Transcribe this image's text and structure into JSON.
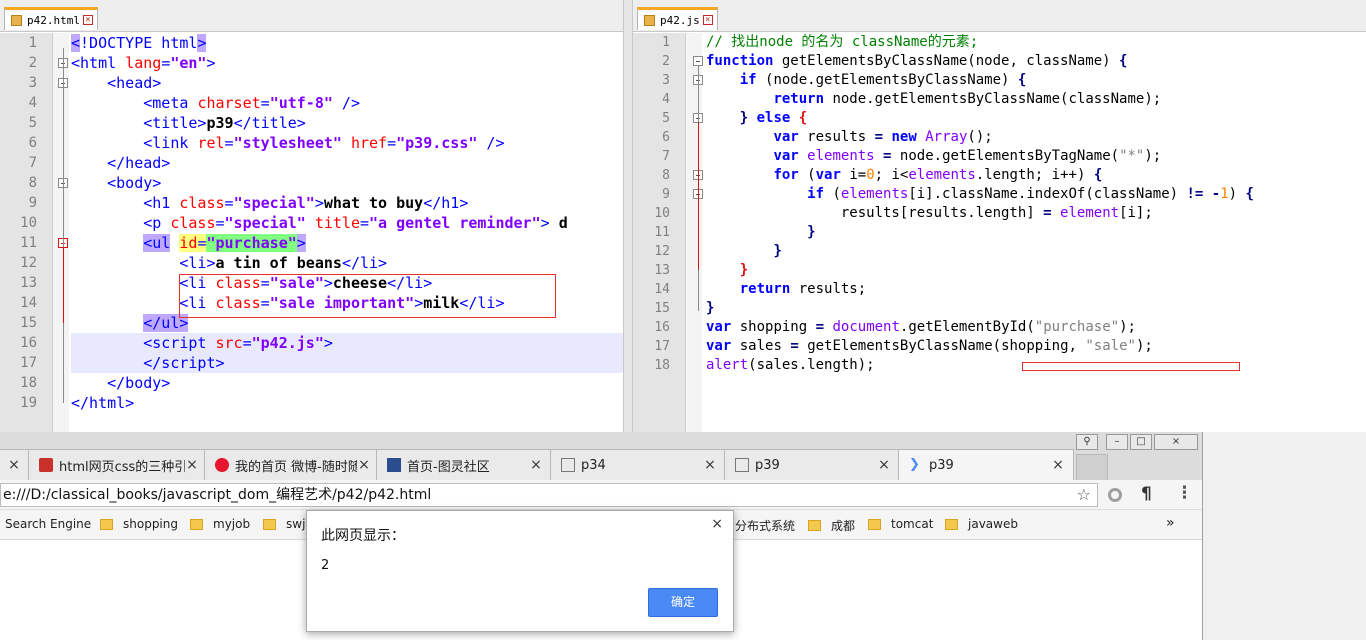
{
  "left_editor": {
    "tab_label": "p42.html",
    "lines": [
      {
        "n": "1",
        "html": "<span class='tg sel-tag'>&lt;</span><span class='tg'>!DOCTYPE html</span><span class='tg sel-tag'>&gt;</span>"
      },
      {
        "n": "2",
        "html": "<span class='tg'>&lt;html </span><span class='at'>lang</span><span class='tg'>=</span><span class='av'>\"en\"</span><span class='tg'>&gt;</span>"
      },
      {
        "n": "3",
        "html": "    <span class='tg'>&lt;head&gt;</span>"
      },
      {
        "n": "4",
        "html": "        <span class='tg'>&lt;meta </span><span class='at'>charset</span><span class='tg'>=</span><span class='av'>\"utf-8\"</span><span class='tg'> /&gt;</span>"
      },
      {
        "n": "5",
        "html": "        <span class='tg'>&lt;title&gt;</span><span class='tx'>p39</span><span class='tg'>&lt;/title&gt;</span>"
      },
      {
        "n": "6",
        "html": "        <span class='tg'>&lt;link </span><span class='at'>rel</span><span class='tg'>=</span><span class='av'>\"stylesheet\"</span><span class='tg'> </span><span class='at'>href</span><span class='tg'>=</span><span class='av'>\"p39.css\"</span><span class='tg'> /&gt;</span>"
      },
      {
        "n": "7",
        "html": "    <span class='tg'>&lt;/head&gt;</span>"
      },
      {
        "n": "8",
        "html": "    <span class='tg'>&lt;body&gt;</span>"
      },
      {
        "n": "9",
        "html": "        <span class='tg'>&lt;h1 </span><span class='at'>class</span><span class='tg'>=</span><span class='av'>\"special\"</span><span class='tg'>&gt;</span><span class='tx'>what to buy</span><span class='tg'>&lt;/h1&gt;</span>"
      },
      {
        "n": "10",
        "html": "        <span class='tg'>&lt;p </span><span class='at'>class</span><span class='tg'>=</span><span class='av'>\"special\"</span><span class='tg'> </span><span class='at'>title</span><span class='tg'>=</span><span class='av'>\"a gentel reminder\"</span><span class='tg'>&gt; </span><span class='tx'>d</span>"
      },
      {
        "n": "11",
        "html": "        <span class='tg sel-tag'>&lt;ul</span> <span class='at sel-attr'>id</span><span class='tg sel-attr'>=</span><span class='av sel-val'>\"purchase\"</span><span class='tg sel-tag'>&gt;</span>"
      },
      {
        "n": "12",
        "html": "            <span class='tg'>&lt;li&gt;</span><span class='tx'>a tin of beans</span><span class='tg'>&lt;/li&gt;</span>"
      },
      {
        "n": "13",
        "html": "            <span class='tg'>&lt;li </span><span class='at'>class</span><span class='tg'>=</span><span class='av'>\"sale\"</span><span class='tg'>&gt;</span><span class='tx'>cheese</span><span class='tg'>&lt;/li&gt;</span>"
      },
      {
        "n": "14",
        "html": "            <span class='tg'>&lt;li </span><span class='at'>class</span><span class='tg'>=</span><span class='av'>\"sale important\"</span><span class='tg'>&gt;</span><span class='tx'>milk</span><span class='tg'>&lt;/li&gt;</span>"
      },
      {
        "n": "15",
        "html": "        <span class='tg sel-tag'>&lt;/ul&gt;</span>"
      },
      {
        "n": "16",
        "html": "        <span class='tg'>&lt;script </span><span class='at'>src</span><span class='tg'>=</span><span class='av'>\"p42.js\"</span><span class='tg'>&gt;</span>"
      },
      {
        "n": "17",
        "html": "        <span class='tg'>&lt;/script&gt;</span>"
      },
      {
        "n": "18",
        "html": "    <span class='tg'>&lt;/body&gt;</span>"
      },
      {
        "n": "19",
        "html": "<span class='tg'>&lt;/html&gt;</span>"
      }
    ]
  },
  "right_editor": {
    "tab_label": "p42.js",
    "lines": [
      {
        "n": "1",
        "html": "<span class='cm'>// 找出node 的名为 className的元素;</span>"
      },
      {
        "n": "2",
        "html": "<span class='kw'>function</span> <span class='pl'>getElementsByClassName(node, className)</span> <span class='op'>{</span>"
      },
      {
        "n": "3",
        "html": "    <span class='kw'>if</span> <span class='pl'>(node.getElementsByClassName)</span> <span class='op'>{</span>"
      },
      {
        "n": "4",
        "html": "        <span class='kw'>return</span> <span class='pl'>node.getElementsByClassName(className);</span>"
      },
      {
        "n": "5",
        "html": "    <span class='op'>}</span> <span class='kw'>else</span> <span class='op' style='color:#d11'>{</span>"
      },
      {
        "n": "6",
        "html": "        <span class='kw'>var</span> <span class='pl'>results</span> <span class='op'>=</span> <span class='kw'>new</span> <span class='fn'>Array</span><span class='pl'>();</span>"
      },
      {
        "n": "7",
        "html": "        <span class='kw'>var</span> <span class='fn'>elements</span> <span class='op'>=</span> <span class='pl'>node.getElementsByTagName(</span><span class='st'>\"*\"</span><span class='pl'>);</span>"
      },
      {
        "n": "8",
        "html": "        <span class='kw'>for</span> <span class='pl'>(</span><span class='kw'>var</span> <span class='pl'>i=</span><span class='nm'>0</span><span class='pl'>; i&lt;</span><span class='fn'>elements</span><span class='pl'>.length; i++)</span> <span class='op'>{</span>"
      },
      {
        "n": "9",
        "html": "            <span class='kw'>if</span> <span class='pl'>(</span><span class='fn'>elements</span><span class='pl'>[i].className.indexOf(className)</span> <span class='op'>!=</span> <span class='op'>-</span><span class='nm'>1</span><span class='pl'>)</span> <span class='op'>{</span>"
      },
      {
        "n": "10",
        "html": "                <span class='pl'>results[results.length]</span> <span class='op'>=</span> <span class='fn'>element</span><span class='pl'>[i];</span>"
      },
      {
        "n": "11",
        "html": "            <span class='op'>}</span>"
      },
      {
        "n": "12",
        "html": "        <span class='op'>}</span>"
      },
      {
        "n": "13",
        "html": "    <span class='op' style='color:#d11'>}</span>"
      },
      {
        "n": "14",
        "html": "    <span class='kw'>return</span> <span class='pl'>results;</span>"
      },
      {
        "n": "15",
        "html": "<span class='op'>}</span>"
      },
      {
        "n": "16",
        "html": "<span class='kw'>var</span> <span class='pl'>shopping</span> <span class='op'>=</span> <span class='fn'>document</span><span class='pl'>.getElementById(</span><span class='st'>\"purchase\"</span><span class='pl'>);</span>"
      },
      {
        "n": "17",
        "html": "<span class='kw'>var</span> <span class='pl'>sales</span> <span class='op'>=</span> <span class='pl'>getElementsByClassName(shopping,</span> <span class='st'>\"sale\"</span><span class='pl'>);</span>"
      },
      {
        "n": "18",
        "html": "<span class='fn'>alert</span><span class='pl'>(sales.length);</span>"
      }
    ]
  },
  "browser": {
    "tabs": [
      {
        "label": "html网页css的三种引"
      },
      {
        "label": "我的首页 微博-随时随"
      },
      {
        "label": "首页-图灵社区"
      },
      {
        "label": "p34"
      },
      {
        "label": "p39"
      },
      {
        "label": "p39"
      }
    ],
    "address": "e:///D:/classical_books/javascript_dom_编程艺术/p42/p42.html",
    "bookmarks": [
      "Search Engine",
      "shopping",
      "myjob",
      "swj",
      "分布式系统",
      "成都",
      "tomcat",
      "javaweb"
    ],
    "more_glyph": "»"
  },
  "dialog": {
    "title": "此网页显示：",
    "message": "2",
    "ok_label": "确定",
    "close_glyph": "×"
  },
  "colors": {
    "ok_button": "#4a8af4",
    "tab_accent": "#f5a623",
    "red_annotation": "#e03030"
  }
}
